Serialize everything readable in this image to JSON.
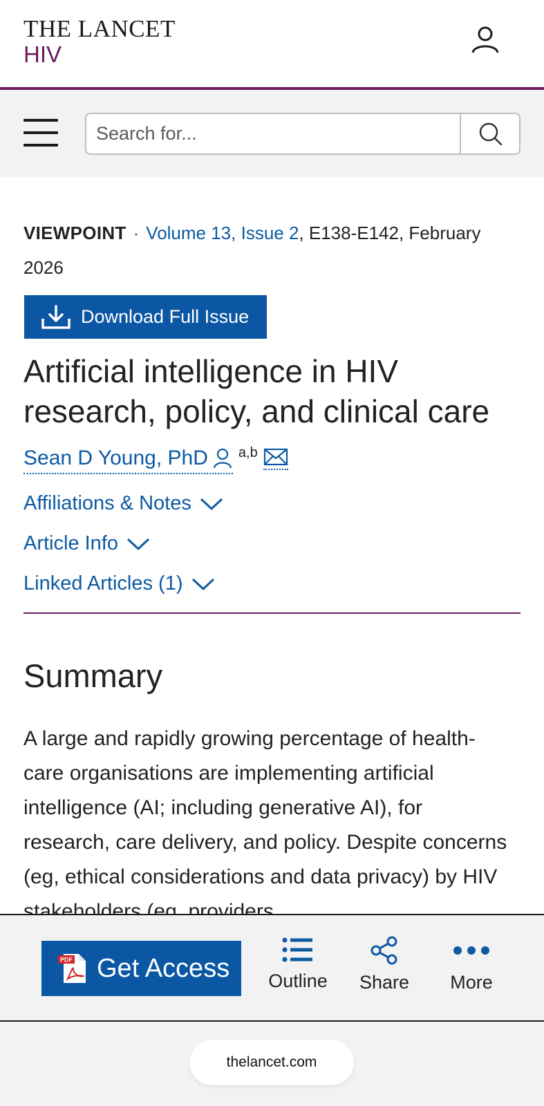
{
  "header": {
    "logo_line1": "THE LANCET",
    "logo_line2": "HIV",
    "account_icon": "person-icon"
  },
  "search": {
    "placeholder": "Search for...",
    "value": "",
    "menu_icon": "hamburger-menu-icon",
    "submit_icon": "search-icon"
  },
  "article": {
    "type": "VIEWPOINT",
    "separator": "·",
    "volume_link": "Volume 13, Issue 2",
    "pages_date": ", E138-E142, February 2026",
    "download_label": "Download Full Issue",
    "title": "Artificial intelligence in HIV research, policy, and clinical care",
    "author": "Sean D Young, PhD",
    "author_affiliations": "a,b",
    "accordions": [
      {
        "label": "Affiliations & Notes"
      },
      {
        "label": "Article Info"
      },
      {
        "label": "Linked Articles (1)"
      }
    ]
  },
  "summary": {
    "heading": "Summary",
    "text": "A large and rapidly growing percentage of health-care organisations are implementing artificial intelligence (AI; including generative AI), for research, care delivery, and policy. Despite concerns (eg, ethical considerations and data privacy) by HIV stakeholders (eg, providers,"
  },
  "actionbar": {
    "get_access_label": "Get Access",
    "outline_label": "Outline",
    "share_label": "Share",
    "more_label": "More"
  },
  "browser": {
    "url": "thelancet.com"
  },
  "colors": {
    "brand_purple": "#6b1a5e",
    "link_blue": "#0b5aa3",
    "button_blue": "#0b57a4"
  }
}
